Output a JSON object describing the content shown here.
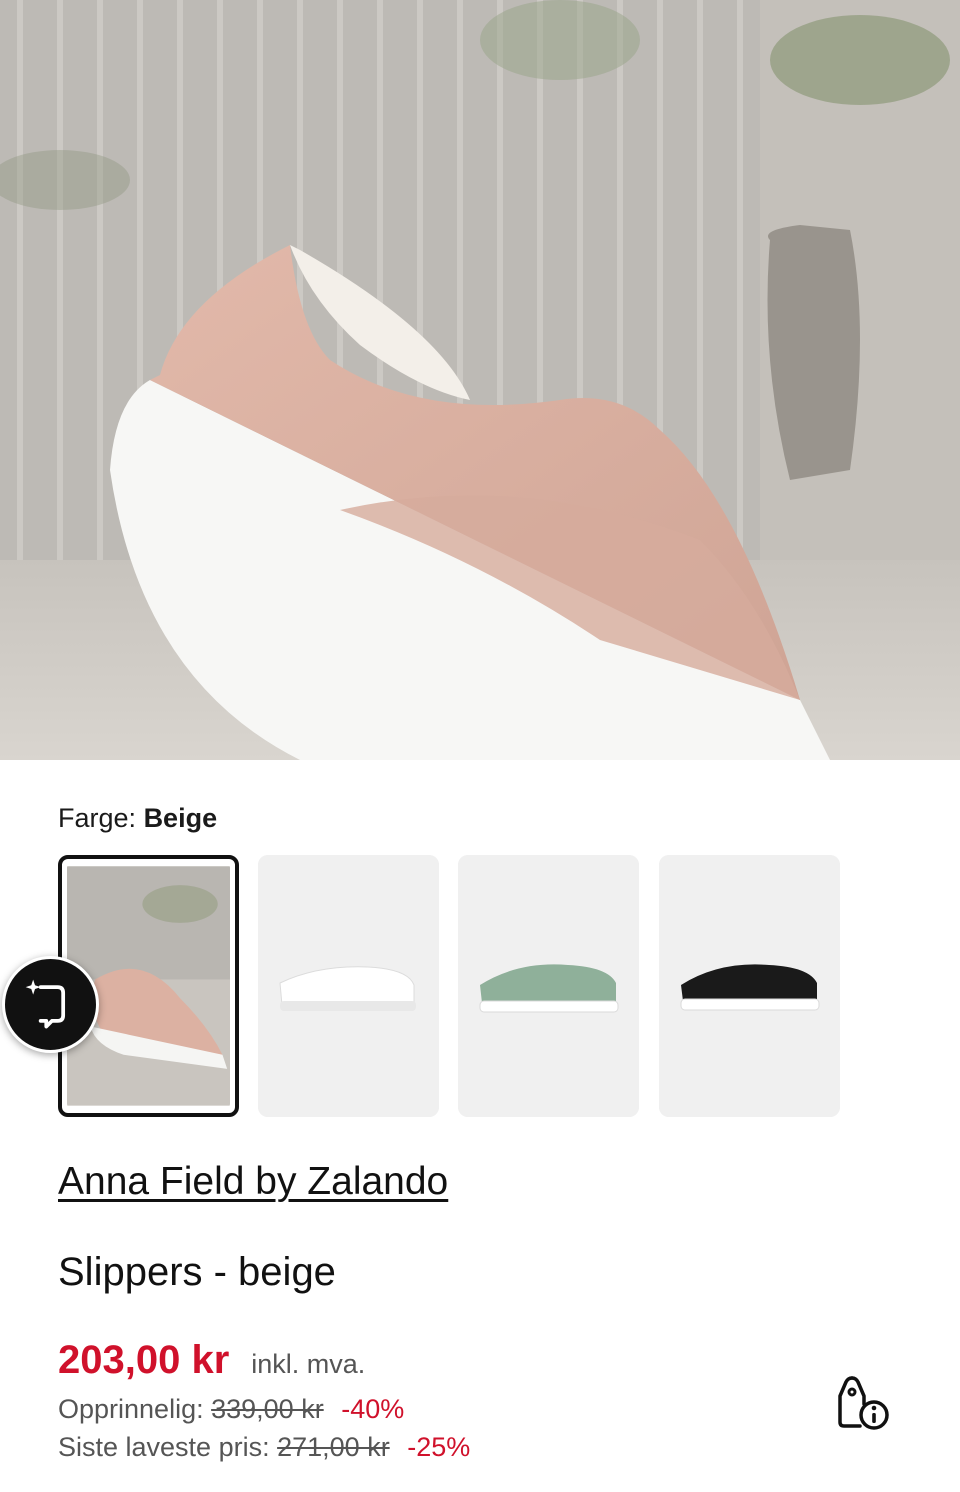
{
  "product": {
    "brand": "Anna Field by Zalando",
    "title": "Slippers - beige",
    "hero_image": "pink-slip-on-sneaker-photo"
  },
  "color": {
    "label": "Farge:",
    "selected": "Beige",
    "options": [
      {
        "name": "beige",
        "selected": true
      },
      {
        "name": "white",
        "selected": false
      },
      {
        "name": "green",
        "selected": false
      },
      {
        "name": "black",
        "selected": false
      }
    ]
  },
  "price": {
    "current": "203,00 kr",
    "vat_note": "inkl. mva.",
    "original_label": "Opprinnelig:",
    "original_value": "339,00 kr",
    "original_discount": "-40%",
    "lowest_label": "Siste laveste pris:",
    "lowest_value": "271,00 kr",
    "lowest_discount": "-25%"
  },
  "icons": {
    "ai_button": "sparkle-crop-icon",
    "price_info": "price-tag-info-icon"
  },
  "colors": {
    "accent_sale": "#d0112b",
    "text": "#1a1a1a",
    "thumb_bg": "#f0f0f0"
  }
}
